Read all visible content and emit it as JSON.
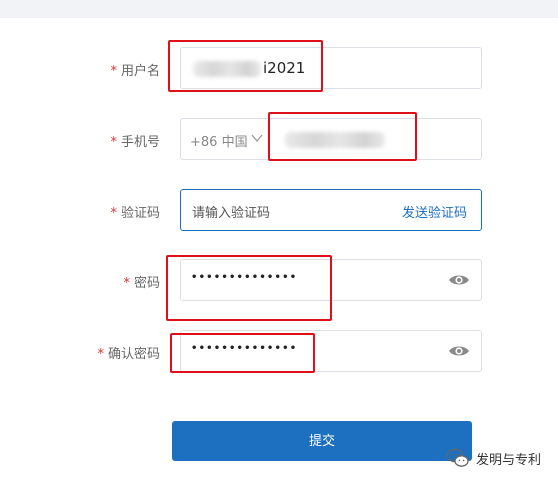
{
  "form": {
    "required_mark": "*",
    "username": {
      "label": "用户名",
      "value_suffix": "i2021"
    },
    "phone": {
      "label": "手机号",
      "country_code": "+86 中国"
    },
    "verify": {
      "label": "验证码",
      "placeholder": "请输入验证码",
      "send_link": "发送验证码"
    },
    "password": {
      "label": "密码",
      "masked": "••••••••••••••"
    },
    "confirm": {
      "label": "确认密码",
      "masked": "••••••••••••••"
    },
    "submit_label": "提交"
  },
  "watermark": {
    "text": "发明与专利"
  },
  "colors": {
    "accent": "#1d6fbf",
    "required": "#e02e2e",
    "annotation": "#e0101a"
  }
}
